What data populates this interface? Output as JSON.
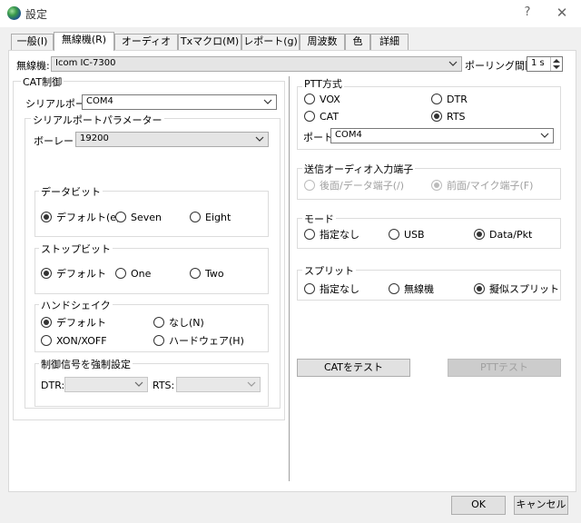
{
  "window": {
    "title": "設定",
    "help": "?",
    "close": "✕"
  },
  "tabs": [
    "一般(I)",
    "無線機(R)",
    "オーディオ(u)",
    "Txマクロ(M)",
    "レポート(g)",
    "周波数",
    "色",
    "詳細"
  ],
  "radio": {
    "label": "無線機:",
    "value": "Icom IC-7300"
  },
  "polling": {
    "label": "ポーリング間隔:",
    "value": "1 s"
  },
  "cat": {
    "title": "CAT制御",
    "serial_port_label": "シリアルポート:",
    "serial_port_value": "COM4",
    "params_title": "シリアルポートパラメーター",
    "baud_label": "ボーレート:",
    "baud_value": "19200",
    "databits": {
      "title": "データビット",
      "opt1": "デフォルト(e)",
      "opt2": "Seven",
      "opt3": "Eight"
    },
    "stopbits": {
      "title": "ストップビット",
      "opt1": "デフォルト",
      "opt2": "One",
      "opt3": "Two"
    },
    "handshake": {
      "title": "ハンドシェイク",
      "opt1": "デフォルト",
      "opt2": "なし(N)",
      "opt3": "XON/XOFF",
      "opt4": "ハードウェア(H)"
    },
    "force": {
      "title": "制御信号を強制設定",
      "dtr_label": "DTR:",
      "dtr_value": "",
      "rts_label": "RTS:",
      "rts_value": ""
    }
  },
  "ptt": {
    "title": "PTT方式",
    "opt_vox": "VOX",
    "opt_dtr": "DTR",
    "opt_cat": "CAT",
    "opt_rts": "RTS",
    "port_label": "ポート:",
    "port_value": "COM4"
  },
  "audio": {
    "title": "送信オーディオ入力端子",
    "opt1": "後面/データ端子(/)",
    "opt2": "前面/マイク端子(F)"
  },
  "mode": {
    "title": "モード",
    "opt1": "指定なし",
    "opt2": "USB",
    "opt3": "Data/Pkt"
  },
  "split": {
    "title": "スプリット",
    "opt1": "指定なし",
    "opt2": "無線機",
    "opt3": "擬似スプリット"
  },
  "buttons": {
    "test_cat": "CATをテスト",
    "test_ptt": "PTTテスト",
    "ok": "OK",
    "cancel": "キャンセル"
  }
}
